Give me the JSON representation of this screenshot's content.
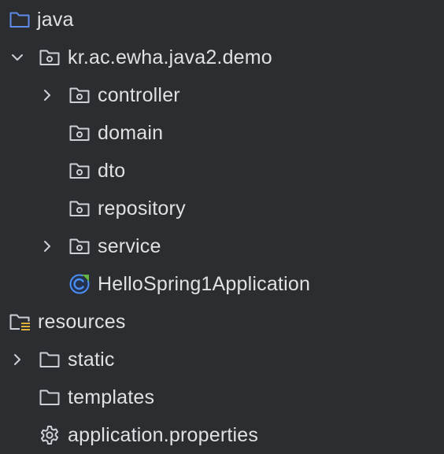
{
  "tree": {
    "java": {
      "label": "java",
      "icon": "source-folder-icon",
      "color": "#5e8ce8"
    },
    "package": {
      "label": "kr.ac.ewha.java2.demo",
      "icon": "package-icon",
      "expanded": true
    },
    "controller": {
      "label": "controller",
      "icon": "package-icon",
      "expanded": false
    },
    "domain": {
      "label": "domain",
      "icon": "package-icon"
    },
    "dto": {
      "label": "dto",
      "icon": "package-icon"
    },
    "repository": {
      "label": "repository",
      "icon": "package-icon"
    },
    "service": {
      "label": "service",
      "icon": "package-icon",
      "expanded": false
    },
    "app": {
      "label": "HelloSpring1Application",
      "icon": "spring-boot-class-icon",
      "color": "#4a8ff5"
    },
    "resources": {
      "label": "resources",
      "icon": "resources-folder-icon"
    },
    "static": {
      "label": "static",
      "icon": "folder-icon",
      "expanded": false
    },
    "templates": {
      "label": "templates",
      "icon": "folder-icon"
    },
    "properties": {
      "label": "application.properties",
      "icon": "gear-icon"
    }
  }
}
